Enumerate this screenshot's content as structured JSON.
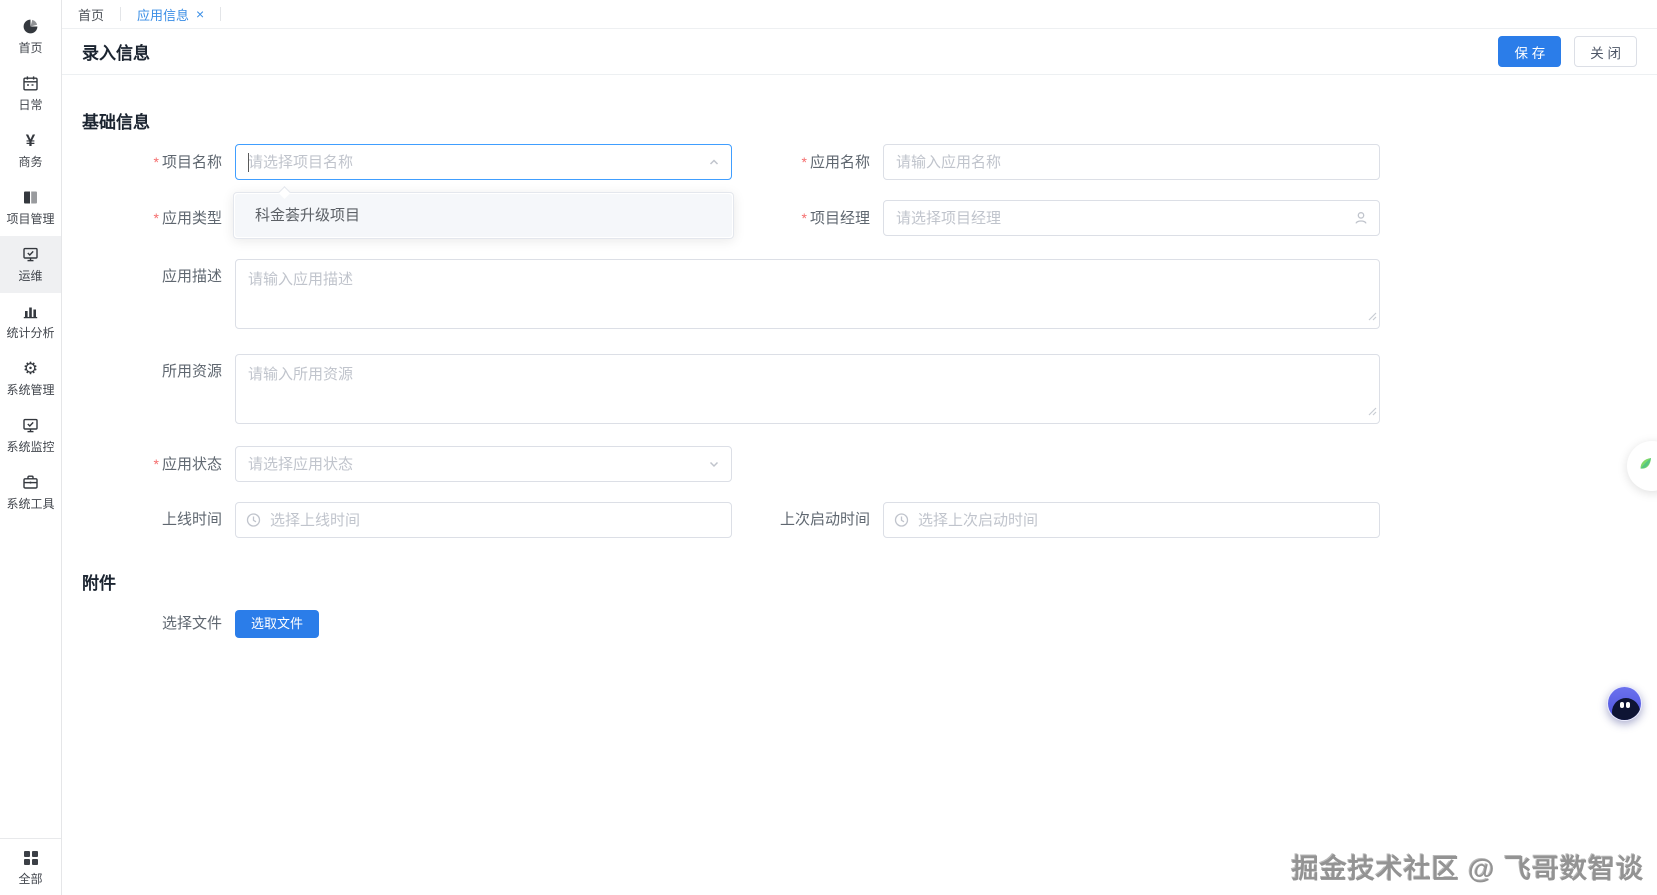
{
  "sidebar": {
    "items": [
      {
        "label": "首页",
        "icon": "dashboard-icon"
      },
      {
        "label": "日常",
        "icon": "calendar-icon"
      },
      {
        "label": "商务",
        "icon": "yuan-icon"
      },
      {
        "label": "项目管理",
        "icon": "book-icon"
      },
      {
        "label": "运维",
        "icon": "monitor-check-icon",
        "active": true
      },
      {
        "label": "统计分析",
        "icon": "bar-chart-icon"
      },
      {
        "label": "系统管理",
        "icon": "gear-icon"
      },
      {
        "label": "系统监控",
        "icon": "monitor-check-icon"
      },
      {
        "label": "系统工具",
        "icon": "briefcase-icon"
      }
    ],
    "bottom_item": {
      "label": "全部",
      "icon": "grid-icon"
    }
  },
  "tabs": {
    "home": {
      "label": "首页"
    },
    "app_info": {
      "label": "应用信息",
      "close_glyph": "×"
    }
  },
  "header": {
    "title": "录入信息",
    "save_label": "保 存",
    "close_label": "关 闭"
  },
  "form": {
    "section_basic": "基础信息",
    "project_name": {
      "label": "项目名称",
      "required": "*",
      "placeholder": "请选择项目名称"
    },
    "app_name": {
      "label": "应用名称",
      "required": "*",
      "placeholder": "请输入应用名称"
    },
    "app_type": {
      "label": "应用类型",
      "required": "*",
      "placeholder": ""
    },
    "project_manager": {
      "label": "项目经理",
      "required": "*",
      "placeholder": "请选择项目经理"
    },
    "app_desc": {
      "label": "应用描述",
      "placeholder": "请输入应用描述"
    },
    "resources": {
      "label": "所用资源",
      "placeholder": "请输入所用资源"
    },
    "app_status": {
      "label": "应用状态",
      "required": "*",
      "placeholder": "请选择应用状态"
    },
    "online_time": {
      "label": "上线时间",
      "placeholder": "选择上线时间"
    },
    "last_start_time": {
      "label": "上次启动时间",
      "placeholder": "选择上次启动时间"
    },
    "dropdown": {
      "options": [
        "科金荟升级项目"
      ]
    },
    "section_attachment": "附件",
    "file_field": {
      "label": "选择文件",
      "button_label": "选取文件"
    }
  },
  "glyphs": {
    "yuan": "¥",
    "gear": "⚙"
  },
  "watermark": "掘金技术社区 @ 飞哥数智谈",
  "colors": {
    "primary_button": "#2b7de9",
    "tab_active": "#3a8ee6",
    "focus_border": "#409eff",
    "required_mark": "#f56c6c",
    "placeholder": "#c0c4cc",
    "input_border": "#dcdfe6"
  }
}
